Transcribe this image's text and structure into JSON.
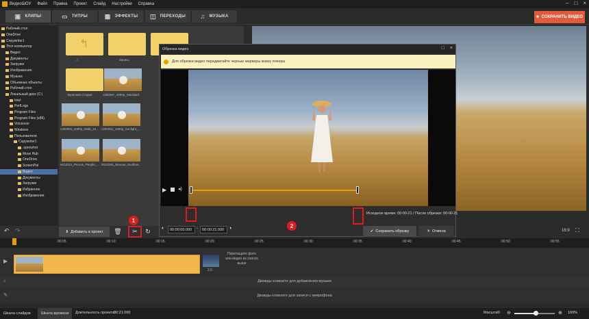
{
  "titlebar": {
    "app_name": "ВидеоШОУ",
    "menu": [
      "Файл",
      "Правка",
      "Проект",
      "Слайд",
      "Настройки",
      "Справка"
    ]
  },
  "tabs": [
    {
      "label": "КЛИПЫ",
      "icon": "film-icon"
    },
    {
      "label": "ТИТРЫ",
      "icon": "titles-icon"
    },
    {
      "label": "ЭФФЕКТЫ",
      "icon": "effects-icon"
    },
    {
      "label": "ПЕРЕХОДЫ",
      "icon": "transitions-icon"
    },
    {
      "label": "МУЗЫКА",
      "icon": "music-icon"
    }
  ],
  "save_video_label": "СОХРАНИТЬ ВИДЕО",
  "tree": [
    "Рабочий стол",
    "OneDrive",
    "Copywriter1",
    "Этот компьютер",
    "Видео",
    "Документы",
    "Загрузки",
    "Изображения",
    "Музыка",
    "Объемные объекты",
    "Рабочий стол",
    "Локальный диск (C:)",
    "Intel",
    "PerfLogs",
    "Program Files",
    "Program Files (x86)",
    "Voiceover",
    "Windows",
    "Пользователи",
    "Copywriter1",
    ".openshot",
    "Muse Hub",
    "OneDrive",
    "ScreenPal",
    "Видео",
    "Документы",
    "Загрузки",
    "Избранное",
    "Изображения"
  ],
  "tree_selected_index": 24,
  "files": [
    {
      "type": "folder",
      "caption": "..\\"
    },
    {
      "type": "folder",
      "caption": "Запись"
    },
    {
      "type": "folder",
      "caption": ""
    },
    {
      "type": "folder",
      "caption": ""
    },
    {
      "type": "folder",
      "caption": "Экранная Студия"
    },
    {
      "type": "video",
      "caption": "c2b0087_1080p_Standard"
    },
    {
      "type": "video",
      "caption": "c2b0001_1080p_Walk_10..."
    },
    {
      "type": "video",
      "caption": "c2b0091_1080p_Sunlight_..."
    },
    {
      "type": "video",
      "caption": "6012021_Person_People_..."
    },
    {
      "type": "video",
      "caption": "6012304_Woman_Sunflow..."
    }
  ],
  "toolbar": {
    "add_to_project": "Добавить в проект"
  },
  "dialog": {
    "title": "Обрезка видео",
    "info": "Для обрезки видео передвигайте черные маркеры  внизу плеера",
    "source_time_label": "Исходное время:",
    "source_time": "00:00:21",
    "after_trim_label": "После обрезки:",
    "after_trim": "00:00:21",
    "start_input": "00:00:00.000",
    "end_input": "00:00:21.000",
    "save_button": "Сохранить обрезку",
    "cancel_button": "Отмена",
    "trim_start_fraction": 0,
    "trim_end_fraction": 1
  },
  "annotations": {
    "badge1": "1",
    "badge2": "2"
  },
  "preview": {
    "aspect": "16:9"
  },
  "ruler": [
    "00:05",
    "00:10",
    "00:15",
    "00:20",
    "00:25",
    "00:30",
    "00:35",
    "00:40",
    "00:45",
    "00:50",
    "00:55"
  ],
  "timeline": {
    "clip_duration": "2.0",
    "drop_hint": "Перетащите фото или видео из списка выше",
    "music_hint": "Дважды кликните для добавления музыки",
    "mic_hint": "Дважды кликните для записи с микрофона"
  },
  "statusbar": {
    "tab_slides": "Шкала слайдов",
    "tab_timeline": "Шкала времени",
    "duration_label": "Длительность проекта:",
    "duration": "00:21.000",
    "zoom_label": "Масштаб:",
    "zoom_value": "100%"
  }
}
